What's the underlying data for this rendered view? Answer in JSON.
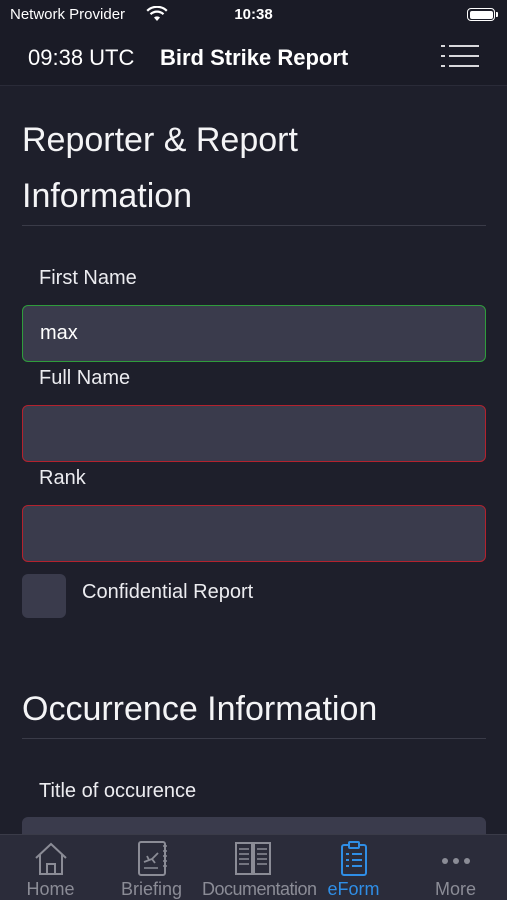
{
  "status_bar": {
    "carrier": "Network Provider",
    "time": "10:38"
  },
  "nav": {
    "utc_time": "09:38 UTC",
    "title": "Bird Strike Report"
  },
  "sections": {
    "reporter": {
      "title_line1": "Reporter & Report",
      "title_line2": "Information"
    },
    "occurrence": {
      "title": "Occurrence Information"
    }
  },
  "form": {
    "first_name": {
      "label": "First Name",
      "value": "max"
    },
    "full_name": {
      "label": "Full Name",
      "value": ""
    },
    "rank": {
      "label": "Rank",
      "value": ""
    },
    "confidential": {
      "label": "Confidential Report",
      "checked": false
    },
    "title_of_occurrence": {
      "label": "Title of occurence",
      "value": ""
    }
  },
  "tabs": [
    {
      "label": "Home",
      "icon": "home-icon"
    },
    {
      "label": "Briefing",
      "icon": "briefing-icon"
    },
    {
      "label": "Documentation",
      "icon": "book-icon"
    },
    {
      "label": "eForm",
      "icon": "clipboard-icon",
      "active": true
    },
    {
      "label": "More",
      "icon": "more-icon"
    }
  ],
  "colors": {
    "background": "#1e1f2b",
    "field": "#3a3b4c",
    "valid_border": "#2f9c3c",
    "invalid_border": "#b3222e",
    "active_tab": "#2f8ee6",
    "inactive_tab": "#8b8c96"
  }
}
